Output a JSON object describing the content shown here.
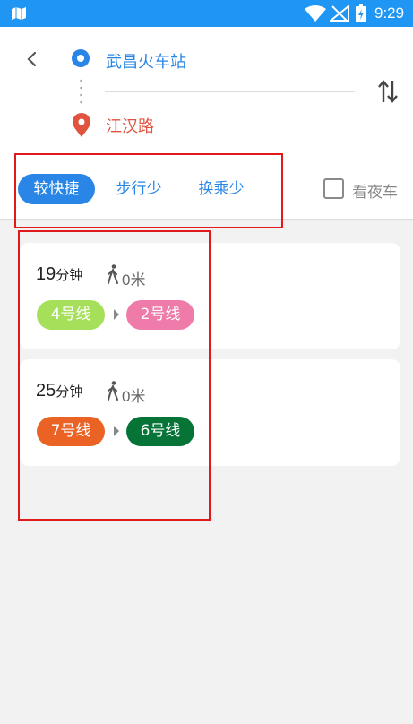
{
  "status_bar": {
    "time": "9:29",
    "app_icon": "map-icon",
    "wifi_icon": "wifi-icon",
    "signal_icon": "no-signal-icon",
    "battery_icon": "battery-charging-icon",
    "color": "#1f96f3"
  },
  "route": {
    "origin": "武昌火车站",
    "destination": "江汉路",
    "back_icon": "chevron-left-icon",
    "swap_icon": "swap-vertical-icon"
  },
  "filters": {
    "tabs": [
      {
        "label": "较快捷",
        "selected": true
      },
      {
        "label": "步行少",
        "selected": false
      },
      {
        "label": "换乘少",
        "selected": false
      }
    ],
    "night_checkbox": {
      "label": "看夜车",
      "checked": false
    }
  },
  "results": [
    {
      "duration_value": "19",
      "duration_unit": "分钟",
      "walk_distance": "0米",
      "lines": [
        {
          "name": "4号线",
          "color": "#a6e05a"
        },
        {
          "name": "2号线",
          "color": "#ee7ba9"
        }
      ]
    },
    {
      "duration_value": "25",
      "duration_unit": "分钟",
      "walk_distance": "0米",
      "lines": [
        {
          "name": "7号线",
          "color": "#ea6224"
        },
        {
          "name": "6号线",
          "color": "#067337"
        }
      ]
    }
  ],
  "colors": {
    "accent": "#2a86e6",
    "destination": "#e0533e",
    "highlight_frame": "#e0191b"
  }
}
